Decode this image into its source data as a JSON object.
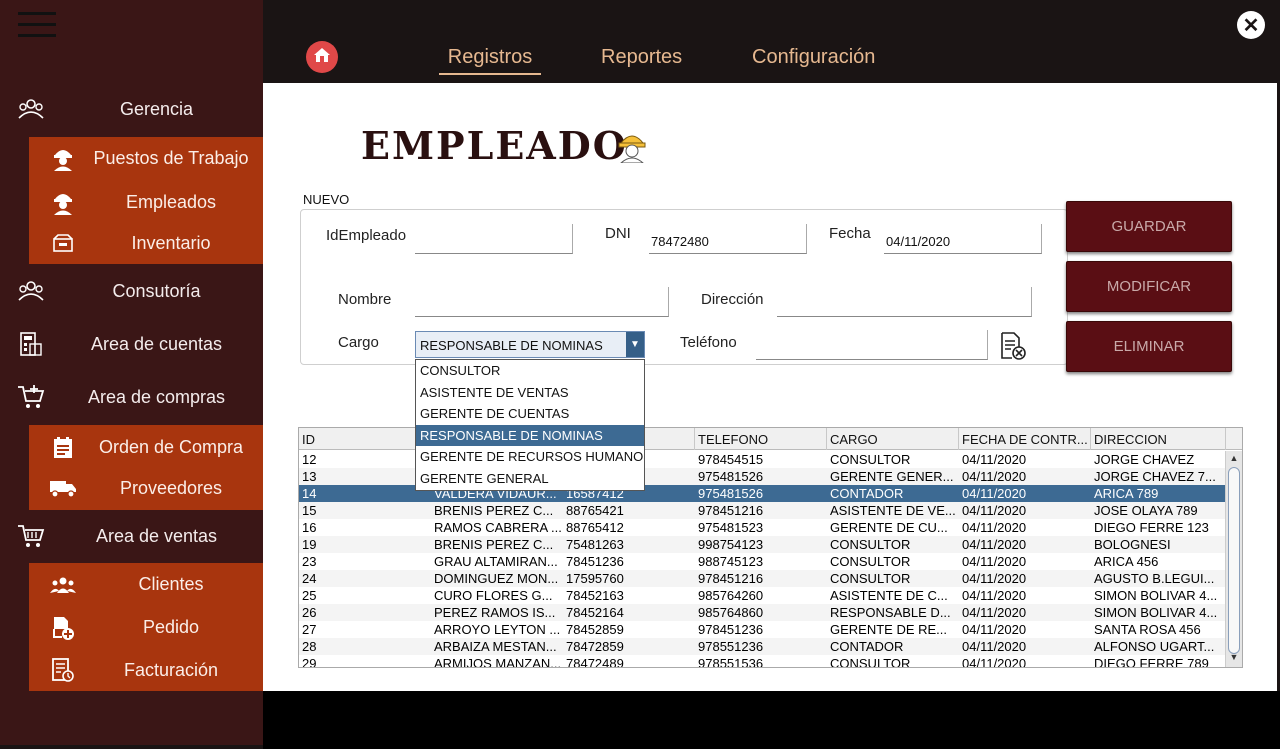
{
  "sidebar": {
    "sections": [
      {
        "label": "Gerencia",
        "icon": "group-icon"
      },
      {
        "label": "Consutoría",
        "icon": "group-icon"
      },
      {
        "label": "Area de cuentas",
        "icon": "calculator-icon"
      },
      {
        "label": "Area de compras",
        "icon": "cart-add-icon"
      },
      {
        "label": "Area de ventas",
        "icon": "cart-icon"
      }
    ],
    "gerencia_items": [
      {
        "label": "Puestos de Trabajo",
        "icon": "worker-icon"
      },
      {
        "label": "Empleados",
        "icon": "worker-icon"
      },
      {
        "label": "Inventario",
        "icon": "inventory-icon"
      }
    ],
    "compras_items": [
      {
        "label": "Orden de Compra",
        "icon": "order-icon"
      },
      {
        "label": "Proveedores",
        "icon": "truck-icon"
      }
    ],
    "ventas_items": [
      {
        "label": "Clientes",
        "icon": "clients-icon"
      },
      {
        "label": "Pedido",
        "icon": "order-add-icon"
      },
      {
        "label": "Facturación",
        "icon": "invoice-icon"
      }
    ]
  },
  "topnav": {
    "tabs": [
      "Registros",
      "Reportes",
      "Configuración"
    ],
    "active": "Registros",
    "close_symbol": "✕"
  },
  "form": {
    "title": "EMPLEADO",
    "section_label": "NUEVO",
    "fields": {
      "id_label": "IdEmpleado",
      "id_value": "",
      "dni_label": "DNI",
      "dni_value": "78472480",
      "fecha_label": "Fecha",
      "fecha_value": "04/11/2020",
      "nombre_label": "Nombre",
      "nombre_value": "",
      "direccion_label": "Dirección",
      "direccion_value": "",
      "cargo_label": "Cargo",
      "cargo_value": "RESPONSABLE DE NOMINAS",
      "telefono_label": "Teléfono",
      "telefono_value": ""
    },
    "cargo_options": [
      "CONSULTOR",
      "ASISTENTE DE VENTAS",
      "GERENTE DE CUENTAS",
      "RESPONSABLE DE NOMINAS",
      "GERENTE DE RECURSOS HUMANOS",
      "GERENTE GENERAL"
    ],
    "cargo_selected_index": 3
  },
  "actions": {
    "guardar": "GUARDAR",
    "modificar": "MODIFICAR",
    "eliminar": "ELIMINAR"
  },
  "table": {
    "columns": [
      "ID",
      "",
      "",
      "TELEFONO",
      "CARGO",
      "FECHA DE CONTR...",
      "DIRECCION"
    ],
    "selected_row": 2,
    "rows": [
      [
        "12",
        "",
        "",
        "978454515",
        "CONSULTOR",
        "04/11/2020",
        "JORGE CHAVEZ"
      ],
      [
        "13",
        "",
        "",
        "975481526",
        "GERENTE GENER...",
        "04/11/2020",
        "JORGE CHAVEZ 7..."
      ],
      [
        "14",
        "VALDERA VIDAUR...",
        "16587412",
        "975481526",
        "CONTADOR",
        "04/11/2020",
        "ARICA 789"
      ],
      [
        "15",
        "BRENIS PEREZ C...",
        "88765421",
        "978451216",
        "ASISTENTE DE VE...",
        "04/11/2020",
        "JOSE OLAYA 789"
      ],
      [
        "16",
        "RAMOS CABRERA ...",
        "88765412",
        "975481523",
        "GERENTE DE CU...",
        "04/11/2020",
        "DIEGO FERRE 123"
      ],
      [
        "19",
        "BRENIS PEREZ C...",
        "75481263",
        "998754123",
        "CONSULTOR",
        "04/11/2020",
        "BOLOGNESI"
      ],
      [
        "23",
        "GRAU ALTAMIRAN...",
        "78451236",
        "988745123",
        "CONSULTOR",
        "04/11/2020",
        "ARICA 456"
      ],
      [
        "24",
        "DOMINGUEZ MON...",
        "17595760",
        "978451216",
        "CONSULTOR",
        "04/11/2020",
        "AGUSTO B.LEGUI..."
      ],
      [
        "25",
        "CURO FLORES G...",
        "78452163",
        "985764260",
        "ASISTENTE DE C...",
        "04/11/2020",
        "SIMON BOLIVAR 4..."
      ],
      [
        "26",
        "PEREZ RAMOS IS...",
        "78452164",
        "985764860",
        "RESPONSABLE D...",
        "04/11/2020",
        "SIMON BOLIVAR 4..."
      ],
      [
        "27",
        "ARROYO LEYTON ...",
        "78452859",
        "978451236",
        "GERENTE DE RE...",
        "04/11/2020",
        "SANTA ROSA 456"
      ],
      [
        "28",
        "ARBAIZA MESTAN...",
        "78472859",
        "978551236",
        "CONTADOR",
        "04/11/2020",
        "ALFONSO UGART..."
      ],
      [
        "29",
        "ARMIJOS MANZAN...",
        "78472489",
        "978551536",
        "CONSULTOR",
        "04/11/2020",
        "DIEGO FERRE 789"
      ]
    ]
  },
  "colors": {
    "sidebar_bg": "#3a1616",
    "submenu_bg": "#a8350e",
    "button_bg": "#5a0e14",
    "accent_tab": "#e6b890",
    "selection": "#3d6a93"
  }
}
